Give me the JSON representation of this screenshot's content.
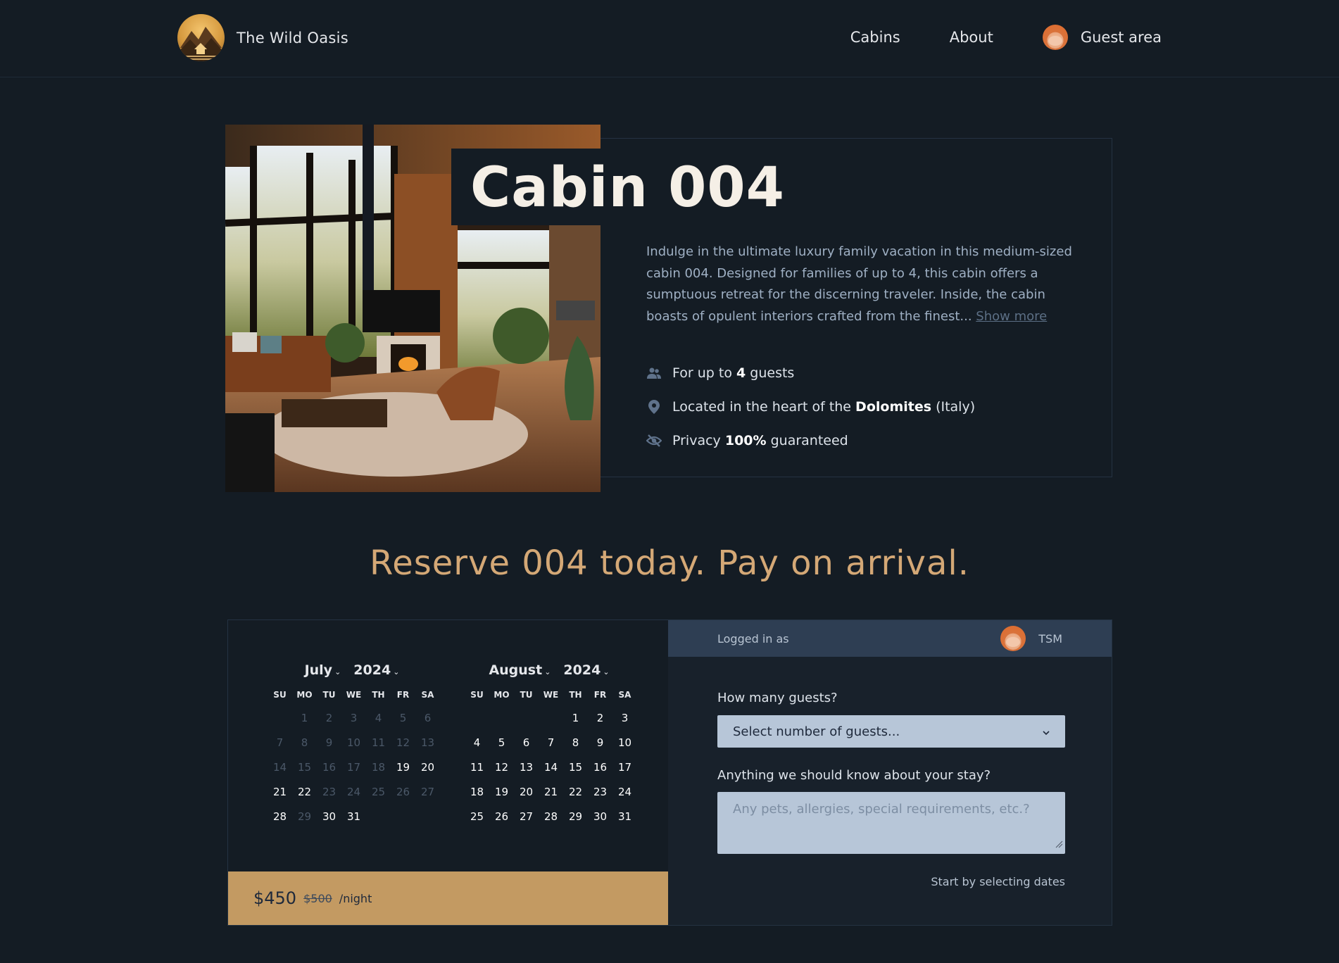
{
  "header": {
    "brand": "The Wild Oasis",
    "nav": {
      "cabins": "Cabins",
      "about": "About",
      "guest_area": "Guest area"
    }
  },
  "cabin": {
    "title": "Cabin 004",
    "description": "Indulge in the ultimate luxury family vacation in this medium-sized cabin 004. Designed for families of up to 4, this cabin offers a sumptuous retreat for the discerning traveler. Inside, the cabin boasts of opulent interiors crafted from the finest...",
    "show_more": "Show more",
    "features": {
      "guests_prefix": "For up to",
      "guests_value": "4",
      "guests_suffix": "guests",
      "location_prefix": "Located in the heart of the",
      "location_value": "Dolomites",
      "location_suffix": "(Italy)",
      "privacy_prefix": "Privacy",
      "privacy_value": "100%",
      "privacy_suffix": "guaranteed"
    },
    "icons": {
      "guests": "users-icon",
      "location": "map-pin-icon",
      "privacy": "eye-slash-icon"
    }
  },
  "reserve": {
    "title": "Reserve 004 today. Pay on arrival."
  },
  "calendar": {
    "weekdays": [
      "SU",
      "MO",
      "TU",
      "WE",
      "TH",
      "FR",
      "SA"
    ],
    "months": [
      {
        "month": "July",
        "year": "2024",
        "leading_blanks": 1,
        "days": [
          {
            "d": "1",
            "disabled": true
          },
          {
            "d": "2",
            "disabled": true
          },
          {
            "d": "3",
            "disabled": true
          },
          {
            "d": "4",
            "disabled": true
          },
          {
            "d": "5",
            "disabled": true
          },
          {
            "d": "6",
            "disabled": true
          },
          {
            "d": "7",
            "disabled": true
          },
          {
            "d": "8",
            "disabled": true
          },
          {
            "d": "9",
            "disabled": true
          },
          {
            "d": "10",
            "disabled": true
          },
          {
            "d": "11",
            "disabled": true
          },
          {
            "d": "12",
            "disabled": true
          },
          {
            "d": "13",
            "disabled": true
          },
          {
            "d": "14",
            "disabled": true
          },
          {
            "d": "15",
            "disabled": true
          },
          {
            "d": "16",
            "disabled": true
          },
          {
            "d": "17",
            "disabled": true
          },
          {
            "d": "18",
            "disabled": true
          },
          {
            "d": "19",
            "disabled": false
          },
          {
            "d": "20",
            "disabled": false
          },
          {
            "d": "21",
            "disabled": false
          },
          {
            "d": "22",
            "disabled": false
          },
          {
            "d": "23",
            "disabled": true
          },
          {
            "d": "24",
            "disabled": true
          },
          {
            "d": "25",
            "disabled": true
          },
          {
            "d": "26",
            "disabled": true
          },
          {
            "d": "27",
            "disabled": true
          },
          {
            "d": "28",
            "disabled": false
          },
          {
            "d": "29",
            "disabled": true
          },
          {
            "d": "30",
            "disabled": false
          },
          {
            "d": "31",
            "disabled": false
          }
        ]
      },
      {
        "month": "August",
        "year": "2024",
        "leading_blanks": 4,
        "days": [
          {
            "d": "1",
            "disabled": false
          },
          {
            "d": "2",
            "disabled": false
          },
          {
            "d": "3",
            "disabled": false
          },
          {
            "d": "4",
            "disabled": false
          },
          {
            "d": "5",
            "disabled": false
          },
          {
            "d": "6",
            "disabled": false
          },
          {
            "d": "7",
            "disabled": false
          },
          {
            "d": "8",
            "disabled": false
          },
          {
            "d": "9",
            "disabled": false
          },
          {
            "d": "10",
            "disabled": false
          },
          {
            "d": "11",
            "disabled": false
          },
          {
            "d": "12",
            "disabled": false
          },
          {
            "d": "13",
            "disabled": false
          },
          {
            "d": "14",
            "disabled": false
          },
          {
            "d": "15",
            "disabled": false
          },
          {
            "d": "16",
            "disabled": false
          },
          {
            "d": "17",
            "disabled": false
          },
          {
            "d": "18",
            "disabled": false
          },
          {
            "d": "19",
            "disabled": false
          },
          {
            "d": "20",
            "disabled": false
          },
          {
            "d": "21",
            "disabled": false
          },
          {
            "d": "22",
            "disabled": false
          },
          {
            "d": "23",
            "disabled": false
          },
          {
            "d": "24",
            "disabled": false
          },
          {
            "d": "25",
            "disabled": false
          },
          {
            "d": "26",
            "disabled": false
          },
          {
            "d": "27",
            "disabled": false
          },
          {
            "d": "28",
            "disabled": false
          },
          {
            "d": "29",
            "disabled": false
          },
          {
            "d": "30",
            "disabled": false
          },
          {
            "d": "31",
            "disabled": false
          }
        ]
      }
    ]
  },
  "price": {
    "current": "$450",
    "original": "$500",
    "unit": "/night"
  },
  "reservation_form": {
    "logged_in_label": "Logged in as",
    "user_name": "TSM",
    "guests_label": "How many guests?",
    "guests_select_value": "Select number of guests...",
    "notes_label": "Anything we should know about your stay?",
    "notes_placeholder": "Any pets, allergies, special requirements, etc.?",
    "hint": "Start by selecting dates"
  },
  "colors": {
    "background": "#141c24",
    "accent": "#c39a62",
    "reserve_title": "#d4a876",
    "logged_bar": "#2e3e53",
    "input_bg": "#b7c6d8"
  }
}
